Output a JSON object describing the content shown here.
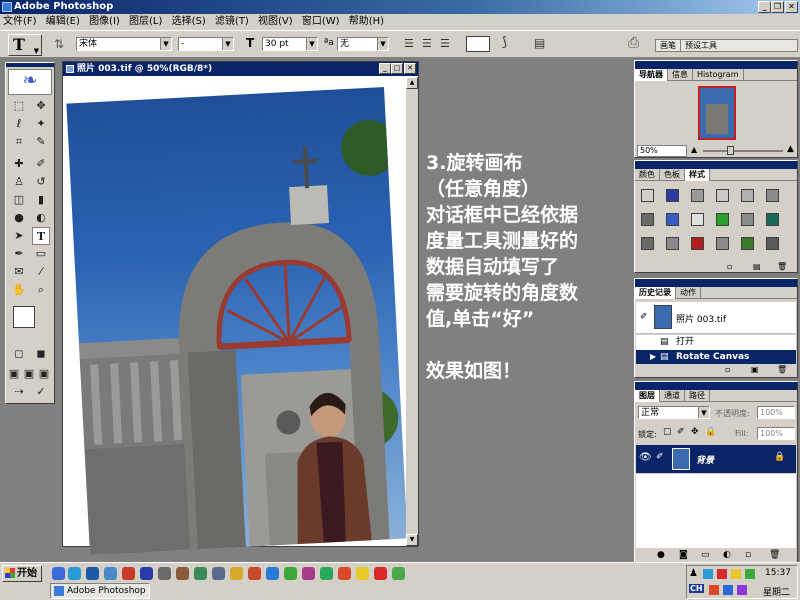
{
  "app": {
    "title": "Adobe Photoshop"
  },
  "menu": [
    "文件(F)",
    "编辑(E)",
    "图像(I)",
    "图层(L)",
    "选择(S)",
    "滤镜(T)",
    "视图(V)",
    "窗口(W)",
    "帮助(H)"
  ],
  "options": {
    "tool_glyph": "T",
    "font_family": "宋体",
    "font_style": "-",
    "font_size": "30 pt",
    "aa_label": "ªa",
    "antialias": "无",
    "palette_well_tabs": [
      "画笔",
      "预设工具"
    ]
  },
  "document": {
    "title": "照片 003.tif @ 50%(RGB/8*)"
  },
  "instruction": {
    "line1": "3.旋转画布",
    "line2": "（任意角度）",
    "line3": "对话框中已经依据",
    "line4": "度量工具测量好的",
    "line5": "数据自动填写了",
    "line6": "需要旋转的角度数",
    "line7": "值,单击“好”",
    "line8": "效果如图！"
  },
  "navigator": {
    "tabs": [
      "导航器",
      "信息",
      "Histogram"
    ],
    "zoom": "50%"
  },
  "swatches": {
    "tabs": [
      "颜色",
      "色板",
      "样式"
    ],
    "colors": [
      "#d4d0c8",
      "#2a3aa0",
      "#9a9a9a",
      "#c8c8c8",
      "#b0b0b0",
      "#8a8a8a",
      "#6a6a6a",
      "#3a5ac8",
      "#e0e0e0",
      "#2aa02a",
      "#8a8a8a",
      "#1a6a5a",
      "#6a6a6a",
      "#8a8a8a",
      "#b02020",
      "#8a8a8a",
      "#3a7a2a",
      "#5a5a5a"
    ]
  },
  "history": {
    "tabs": [
      "历史记录",
      "动作"
    ],
    "snapshot": "照片 003.tif",
    "items": [
      "打开",
      "Rotate Canvas"
    ]
  },
  "layers": {
    "tabs": [
      "图层",
      "通道",
      "路径"
    ],
    "blend_mode": "正常",
    "opacity_label": "不透明度:",
    "opacity": "100%",
    "lock_label": "锁定:",
    "fill_label": "Fill:",
    "fill": "100%",
    "layer_name": "背景"
  },
  "taskbar": {
    "start": "开始",
    "task": "Adobe Photoshop",
    "time": "15:37",
    "day": "星期二",
    "ime": "CH"
  }
}
